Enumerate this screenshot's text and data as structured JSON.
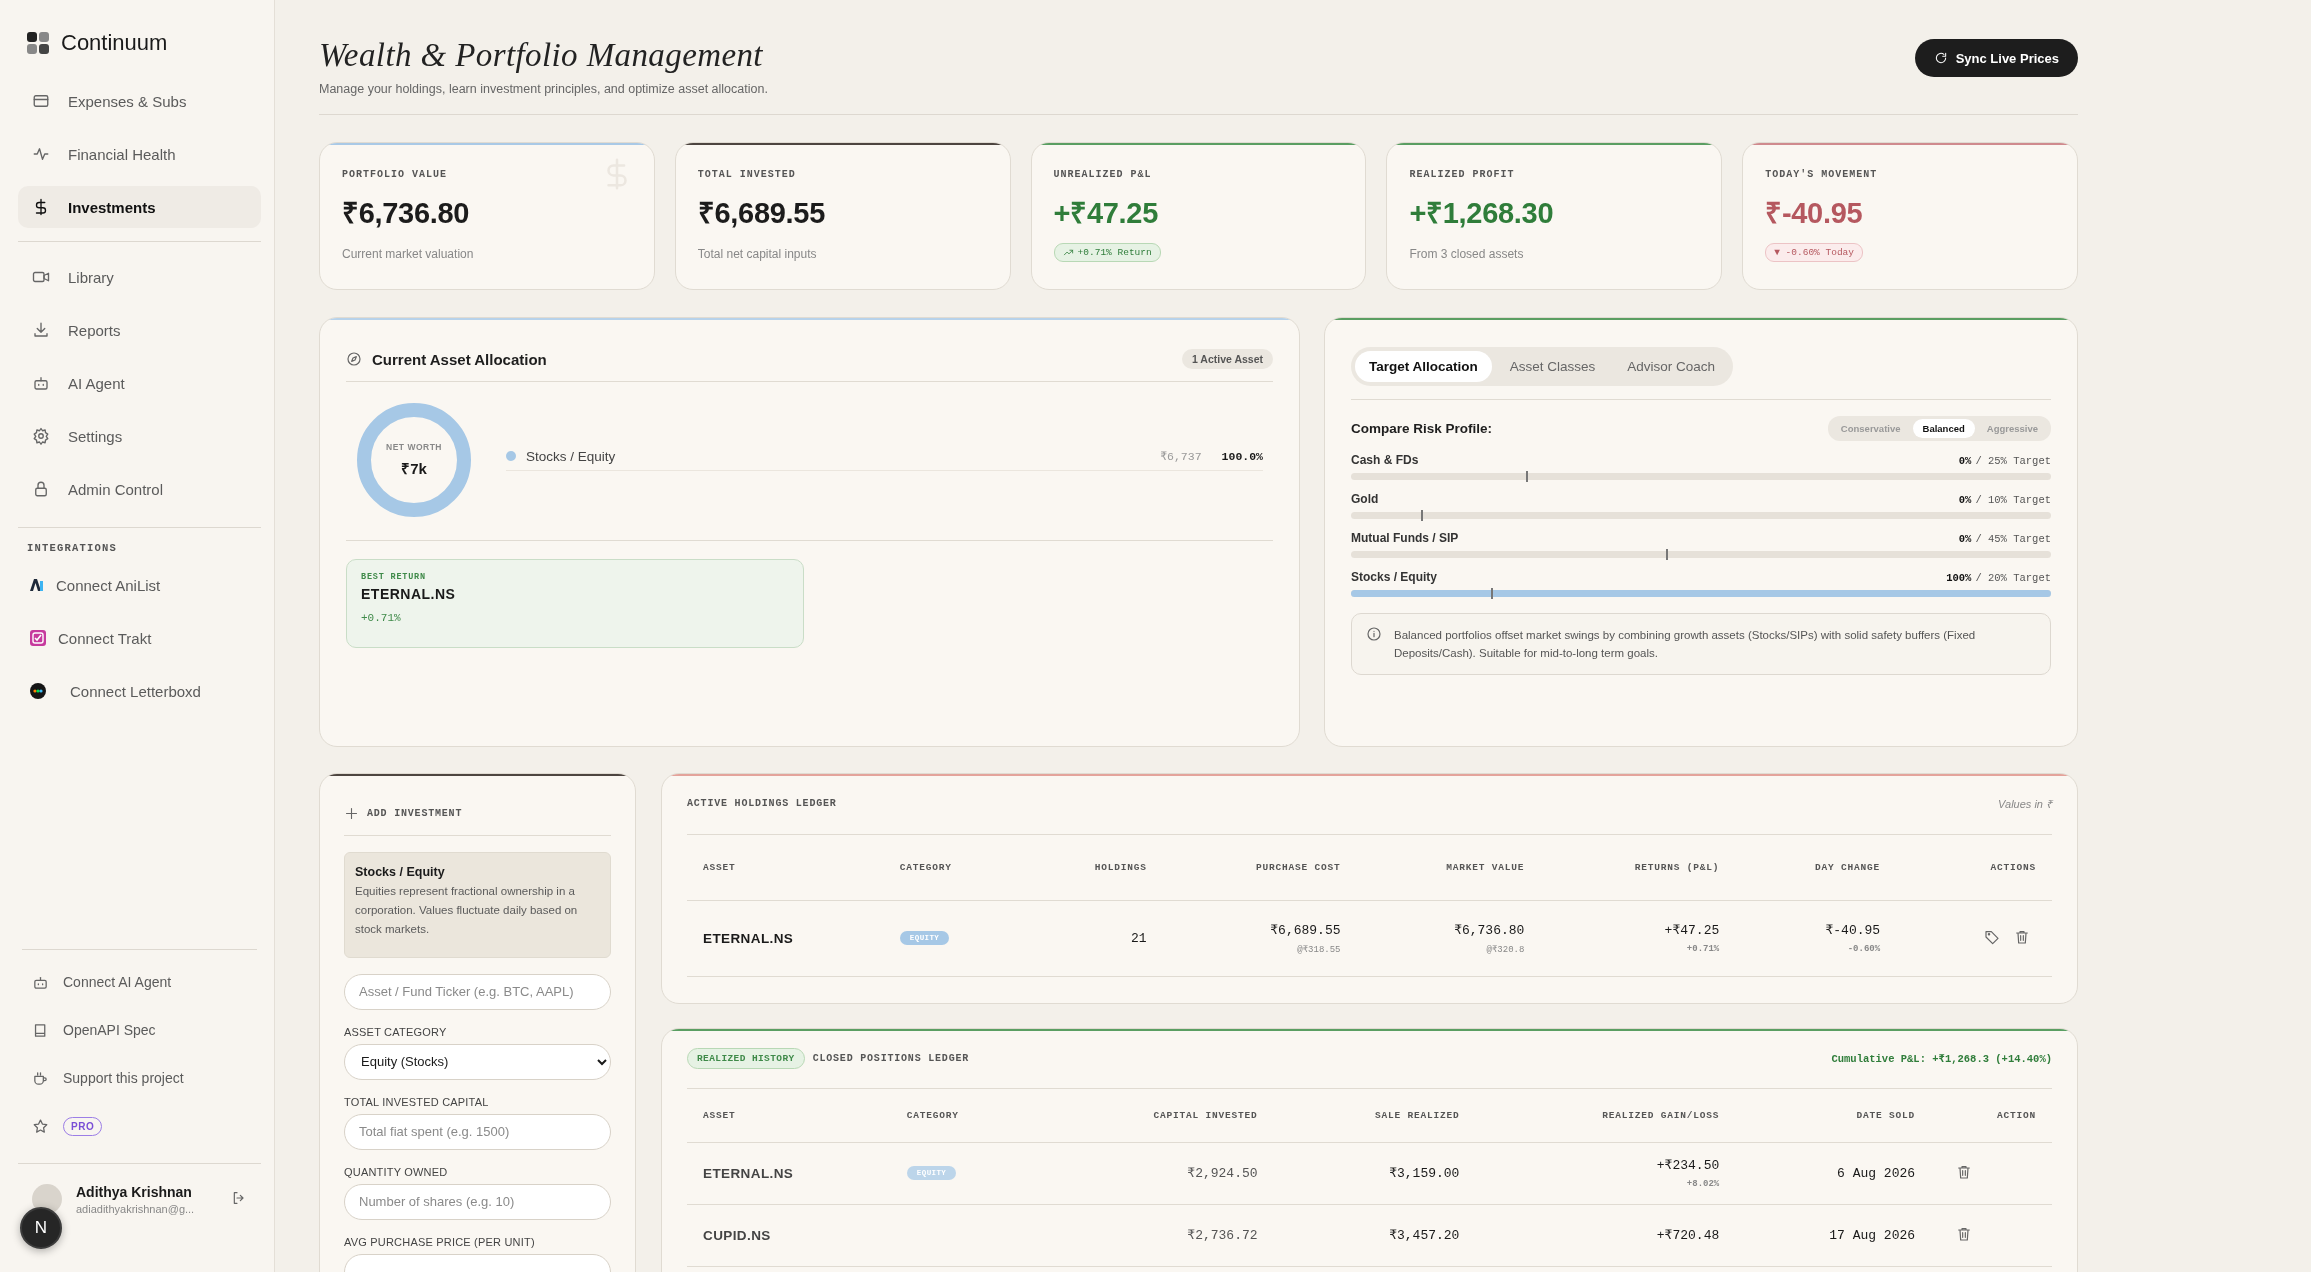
{
  "sidebar": {
    "brand": "Continuum",
    "nav_primary": [
      {
        "label": "Expenses & Subs",
        "selected": false
      },
      {
        "label": "Financial Health",
        "selected": false
      },
      {
        "label": "Investments",
        "selected": true
      }
    ],
    "nav_secondary": [
      {
        "label": "Library",
        "selected": false
      },
      {
        "label": "Reports",
        "selected": false
      },
      {
        "label": "AI Agent",
        "selected": false
      },
      {
        "label": "Settings",
        "selected": false
      },
      {
        "label": "Admin Control",
        "selected": false
      }
    ],
    "integrations_label": "INTEGRATIONS",
    "integrations": [
      {
        "label": "Connect AniList",
        "kind": "anilist"
      },
      {
        "label": "Connect Trakt",
        "kind": "trakt"
      },
      {
        "label": "Connect Letterboxd",
        "kind": "letterboxd"
      }
    ],
    "footer_links": [
      {
        "label": "Connect AI Agent"
      },
      {
        "label": "OpenAPI Spec"
      },
      {
        "label": "Support this project"
      }
    ],
    "pro_badge": "PRO",
    "user": {
      "name": "Adithya Krishnan",
      "email": "adiadithyakrishnan@g..."
    },
    "dev_badge": "N"
  },
  "header": {
    "title": "Wealth & Portfolio Management",
    "subtitle": "Manage your holdings, learn investment principles, and optimize asset allocation.",
    "sync_button": "Sync Live Prices"
  },
  "stat_cards": [
    {
      "label": "PORTFOLIO VALUE",
      "value": "₹6,736.80",
      "note": "Current market valuation",
      "kind": "neutral",
      "color": "#a9c9e6"
    },
    {
      "label": "TOTAL INVESTED",
      "value": "₹6,689.55",
      "note": "Total net capital inputs",
      "kind": "neutral",
      "color": "#4d4540"
    },
    {
      "label": "UNREALIZED P&L",
      "value": "+₹47.25",
      "badge": "+0.71% Return",
      "kind": "gain",
      "color": "#5a9e62"
    },
    {
      "label": "REALIZED PROFIT",
      "value": "+₹1,268.30",
      "note": "From 3 closed assets",
      "kind": "gain",
      "color": "#5a9e62"
    },
    {
      "label": "TODAY'S MOVEMENT",
      "value": "₹-40.95",
      "badge": "▼ -0.60% Today",
      "kind": "loss",
      "color": "#cf8a8e"
    }
  ],
  "allocation": {
    "title": "Current Asset Allocation",
    "badge": "1 Active Asset",
    "center_label": "NET WORTH",
    "center_value": "₹7k",
    "legend": [
      {
        "name": "Stocks / Equity",
        "color": "#a6c8e6",
        "amount": "₹6,737",
        "share": "100.0%"
      }
    ],
    "best_return": {
      "label": "BEST RETURN",
      "asset": "ETERNAL.NS",
      "change": "+0.71%"
    }
  },
  "target": {
    "tabs": [
      {
        "label": "Target Allocation",
        "selected": true
      },
      {
        "label": "Asset Classes",
        "selected": false
      },
      {
        "label": "Advisor Coach",
        "selected": false
      }
    ],
    "compare_label": "Compare Risk Profile:",
    "profiles": [
      {
        "label": "Conservative",
        "selected": false
      },
      {
        "label": "Balanced",
        "selected": true
      },
      {
        "label": "Aggressive",
        "selected": false
      }
    ],
    "rows": [
      {
        "name": "Cash & FDs",
        "current": "0%",
        "target": "/ 25% Target",
        "bar": {
          "level": 0
        },
        "target_marker": {
          "level": 0.25
        }
      },
      {
        "name": "Gold",
        "current": "0%",
        "target": "/ 10% Target",
        "bar": {
          "level": 0
        },
        "target_marker": {
          "level": 0.1
        }
      },
      {
        "name": "Mutual Funds / SIP",
        "current": "0%",
        "target": "/ 45% Target",
        "bar": {
          "level": 0
        },
        "target_marker": {
          "level": 0.45
        }
      },
      {
        "name": "Stocks / Equity",
        "current": "100%",
        "target": "/ 20% Target",
        "bar": {
          "level": 1
        },
        "target_marker": {
          "level": 0.2
        }
      }
    ],
    "note": "Balanced portfolios offset market swings by combining growth assets (Stocks/SIPs) with solid safety buffers (Fixed Deposits/Cash). Suitable for mid-to-long term goals."
  },
  "add_investment": {
    "title": "ADD INVESTMENT",
    "info_title": "Stocks / Equity",
    "info_text": "Equities represent fractional ownership in a corporation. Values fluctuate daily based on stock markets.",
    "fields": [
      {
        "kind": "input",
        "placeholder": "Asset / Fund Ticker (e.g. BTC, AAPL)"
      },
      {
        "kind": "select",
        "label": "ASSET CATEGORY",
        "value": "Equity (Stocks)"
      },
      {
        "kind": "input",
        "label": "TOTAL INVESTED CAPITAL",
        "placeholder": "Total fiat spent (e.g. 1500)"
      },
      {
        "kind": "input",
        "label": "QUANTITY OWNED",
        "placeholder": "Number of shares (e.g. 10)"
      },
      {
        "kind": "input",
        "label": "AVG PURCHASE PRICE (PER UNIT)"
      }
    ]
  },
  "holdings": {
    "title": "ACTIVE HOLDINGS LEDGER",
    "note": "Values in ₹",
    "columns": [
      "ASSET",
      "CATEGORY",
      "HOLDINGS",
      "PURCHASE COST",
      "MARKET VALUE",
      "RETURNS (P&L)",
      "DAY CHANGE",
      "ACTIONS"
    ],
    "rows": [
      {
        "asset": "ETERNAL.NS",
        "category": "EQUITY",
        "holdings": "21",
        "cost": "₹6,689.55",
        "cost_unit": "@₹318.55",
        "value": "₹6,736.80",
        "value_unit": "@₹320.8",
        "returns": {
          "value": "+₹47.25",
          "percent": "+0.71%",
          "kind": "gain"
        },
        "day": {
          "value": "₹-40.95",
          "percent": "-0.60%",
          "kind": "loss"
        }
      }
    ]
  },
  "realized": {
    "badge": "REALIZED HISTORY",
    "title": "CLOSED POSITIONS LEDGER",
    "cumulative": "Cumulative P&L: +₹1,268.3 (+14.40%)",
    "columns": [
      "ASSET",
      "CATEGORY",
      "CAPITAL INVESTED",
      "SALE REALIZED",
      "REALIZED GAIN/LOSS",
      "DATE SOLD",
      "ACTION"
    ],
    "rows": [
      {
        "asset": "ETERNAL.NS",
        "category": "EQUITY",
        "invested": "₹2,924.50",
        "sale": "₹3,159.00",
        "gain": "+₹234.50",
        "gain_pct": "+8.02%",
        "kind": "gain",
        "date": "6 Aug 2026"
      },
      {
        "asset": "CUPID.NS",
        "invested": "₹2,736.72",
        "sale": "₹3,457.20",
        "gain": "+₹720.48",
        "kind": "gain",
        "date": "17 Aug 2026"
      }
    ]
  }
}
